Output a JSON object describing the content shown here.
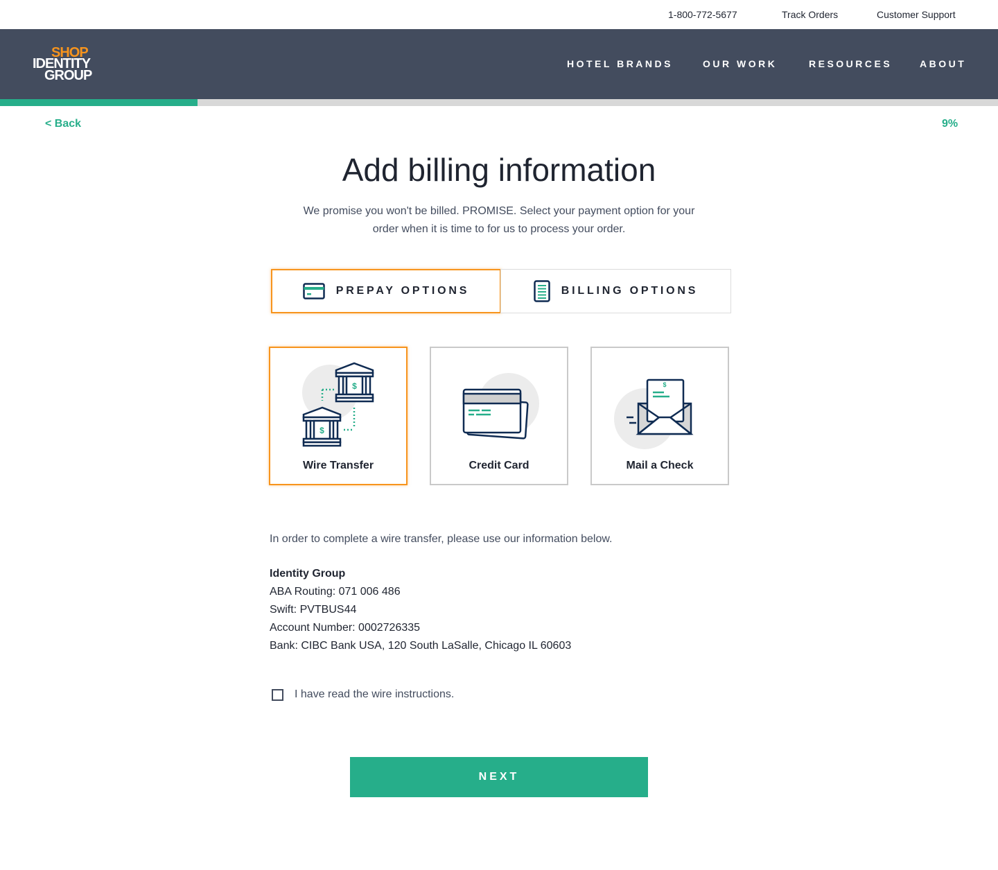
{
  "utility": {
    "phone": "1-800-772-5677",
    "track_orders": "Track Orders",
    "customer_support": "Customer Support"
  },
  "logo": {
    "line1": "SHOP",
    "line2": "IDENTITY",
    "line3": "GROUP"
  },
  "nav": {
    "items": [
      "HOTEL BRANDS",
      "OUR WORK",
      "RESOURCES",
      "ABOUT"
    ]
  },
  "progress": {
    "percent": 9,
    "label": "9%"
  },
  "back_label": "< Back",
  "title": "Add billing information",
  "subtitle": "We promise you won't be billed. PROMISE. Select your payment option for your order when it is time to for us to process your order.",
  "tabs": [
    {
      "label": "PREPAY OPTIONS",
      "icon": "credit-card-icon",
      "active": true
    },
    {
      "label": "BILLING OPTIONS",
      "icon": "invoice-icon",
      "active": false
    }
  ],
  "payment_options": [
    {
      "label": "Wire Transfer",
      "icon": "bank-transfer-icon",
      "active": true
    },
    {
      "label": "Credit Card",
      "icon": "credit-cards-icon",
      "active": false
    },
    {
      "label": "Mail a Check",
      "icon": "envelope-icon",
      "active": false
    }
  ],
  "wire": {
    "intro": "In order to complete a wire transfer, please use our information below.",
    "company": "Identity Group",
    "routing": "ABA Routing: 071 006 486",
    "swift": "Swift: PVTBUS44",
    "account": "Account Number: 0002726335",
    "bank": "Bank: CIBC Bank USA, 120 South LaSalle, Chicago IL 60603"
  },
  "checkbox_label": "I have read the wire instructions.",
  "next_label": "NEXT",
  "colors": {
    "accent": "#26ae8a",
    "brand_orange": "#f7941d",
    "header_bg": "#434c5e",
    "icon_navy": "#0f2b52"
  }
}
